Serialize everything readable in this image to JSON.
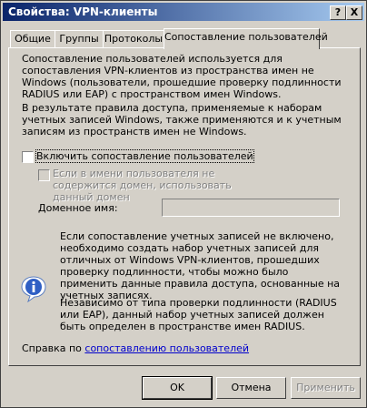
{
  "window": {
    "title": "Свойства: VPN-клиенты"
  },
  "titlebar_buttons": {
    "help": "?",
    "close": "X"
  },
  "tabs": [
    {
      "label": "Общие"
    },
    {
      "label": "Группы"
    },
    {
      "label": "Протоколы"
    },
    {
      "label": "Сопоставление пользователей"
    }
  ],
  "content": {
    "para1": "Сопоставление пользователей используется для сопоставления VPN-клиентов из пространства имен не Windows (пользователи, прошедшие проверку подлинности RADIUS или EAP) с пространством имен Windows.",
    "para2": "В результате правила доступа, применяемые к наборам учетных записей Windows, также применяются и к учетным записям из пространств имен не Windows.",
    "enable_mapping_label": "Включить сопоставление пользователей",
    "enable_mapping_checked": false,
    "nodomain_label": "Если в имени пользователя не содержится домен, использовать данный домен",
    "nodomain_checked": false,
    "domain_name_label": "Доменное имя:",
    "domain_name_value": "",
    "info_para1": "Если сопоставление учетных записей не включено, необходимо создать набор учетных записей для отличных от Windows VPN-клиентов, прошедших проверку подлинности, чтобы можно было применить данные правила доступа, основанные на учетных записях.",
    "info_para2": "Независимо от типа проверки подлинности (RADIUS или EAP), данный набор учетных записей должен быть определен в пространстве имен RADIUS.",
    "help_prefix": "Справка по",
    "help_link": "сопоставлению пользователей"
  },
  "buttons": {
    "ok": "OK",
    "cancel": "Отмена",
    "apply": "Применить"
  },
  "icons": {
    "info": "info-icon"
  },
  "colors": {
    "titlebar_start": "#0a246a",
    "titlebar_end": "#a6caf0",
    "link": "#0000cc",
    "face": "#d4d0c8"
  }
}
